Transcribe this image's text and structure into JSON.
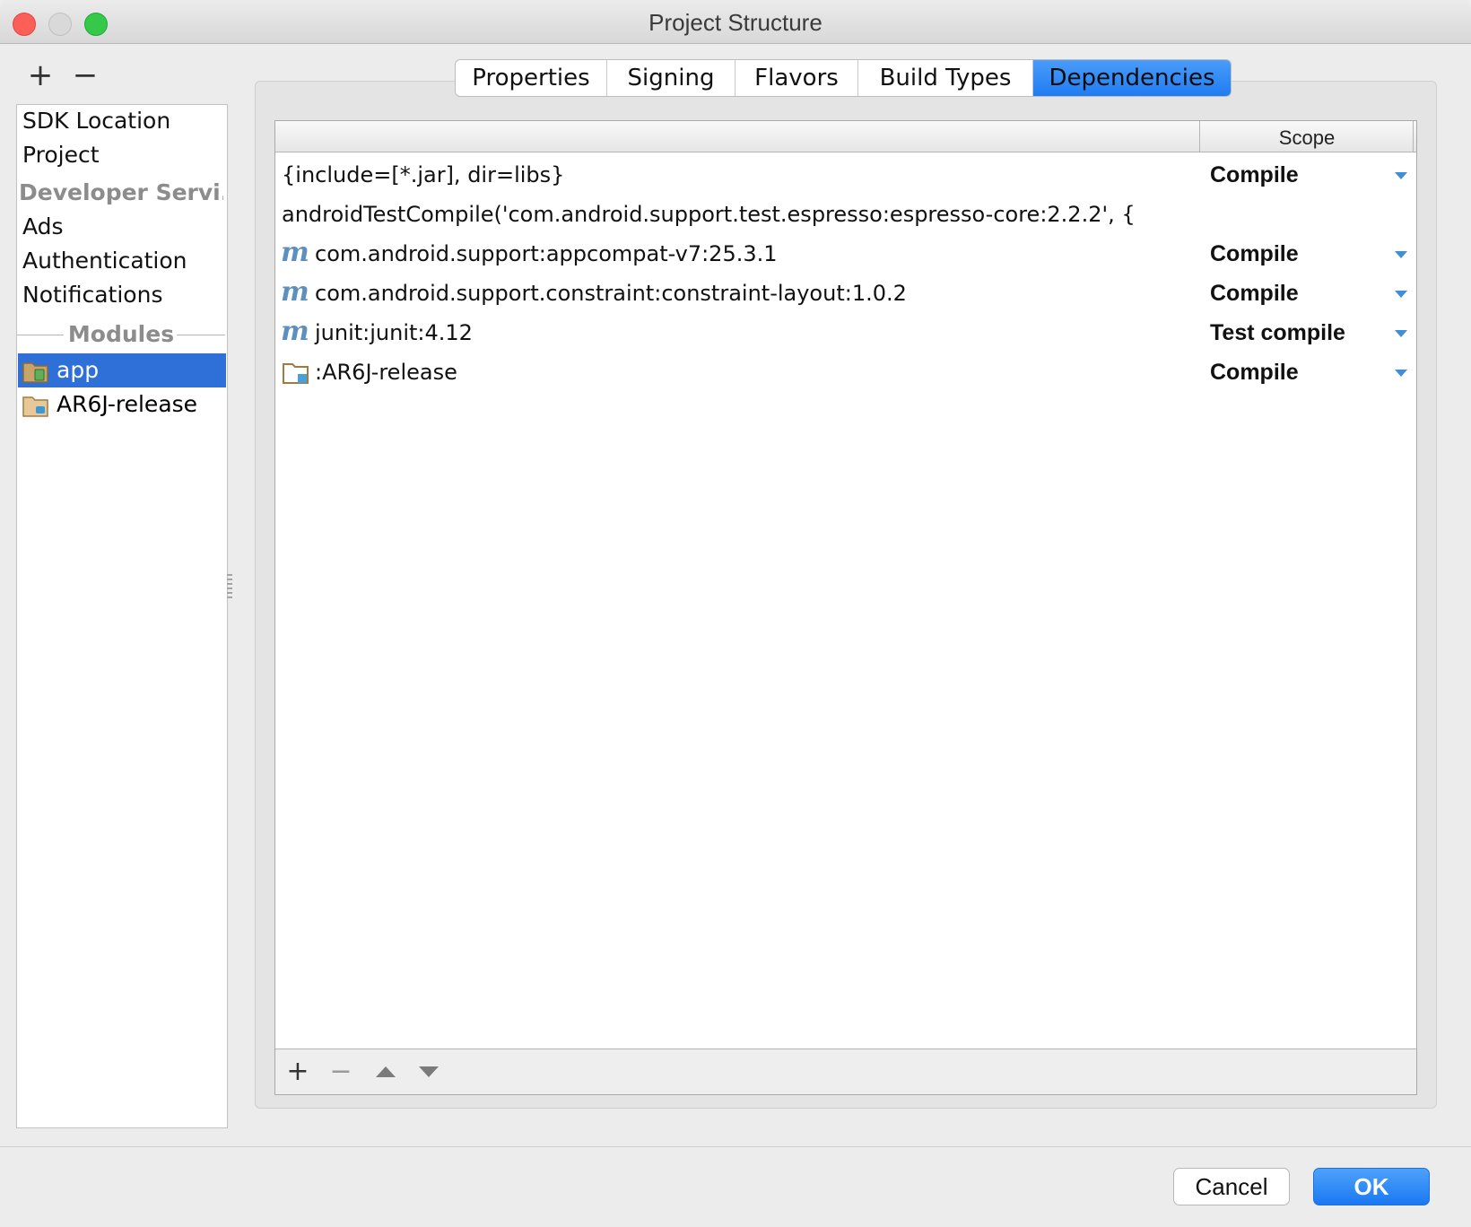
{
  "window": {
    "title": "Project Structure"
  },
  "left_toolbar": {
    "add": "+",
    "remove": "−"
  },
  "sidebar": {
    "items": [
      {
        "label": "SDK Location"
      },
      {
        "label": "Project"
      }
    ],
    "developer_services_header": "Developer Servi...",
    "developer_services": [
      {
        "label": "Ads"
      },
      {
        "label": "Authentication"
      },
      {
        "label": "Notifications"
      }
    ],
    "modules_header": "Modules",
    "modules": [
      {
        "label": "app",
        "selected": true
      },
      {
        "label": "AR6J-release",
        "selected": false
      }
    ]
  },
  "tabs": [
    {
      "label": "Properties",
      "active": false
    },
    {
      "label": "Signing",
      "active": false
    },
    {
      "label": "Flavors",
      "active": false
    },
    {
      "label": "Build Types",
      "active": false
    },
    {
      "label": "Dependencies",
      "active": true
    }
  ],
  "table": {
    "columns": [
      "",
      "Scope"
    ],
    "rows": [
      {
        "icon": "none",
        "dependency": "{include=[*.jar], dir=libs}",
        "scope": "Compile"
      },
      {
        "icon": "none",
        "dependency": "androidTestCompile('com.android.support.test.espresso:espresso-core:2.2.2', {",
        "scope": ""
      },
      {
        "icon": "maven-library-icon",
        "dependency": "com.android.support:appcompat-v7:25.3.1",
        "scope": "Compile"
      },
      {
        "icon": "maven-library-icon",
        "dependency": "com.android.support.constraint:constraint-layout:1.0.2",
        "scope": "Compile"
      },
      {
        "icon": "maven-library-icon",
        "dependency": "junit:junit:4.12",
        "scope": "Test compile"
      },
      {
        "icon": "module-folder-icon",
        "dependency": ":AR6J-release",
        "scope": "Compile"
      }
    ],
    "footer": {
      "add": "+",
      "remove": "−"
    }
  },
  "buttons": {
    "cancel": "Cancel",
    "ok": "OK"
  },
  "colors": {
    "selection": "#2f6fd8",
    "accent": "#1f7cf2",
    "maven_icon": "#5d8fbf",
    "folder": "#c59a5a"
  }
}
